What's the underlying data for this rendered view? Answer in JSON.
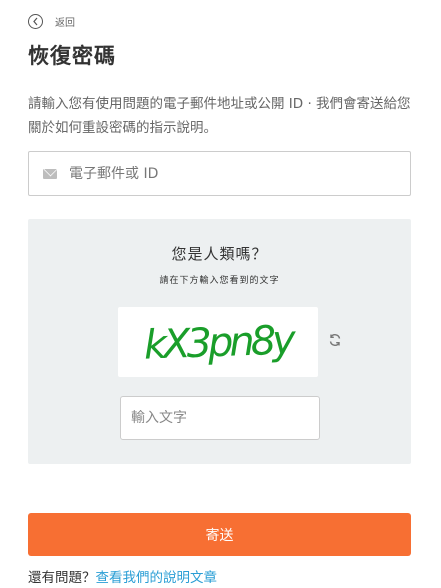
{
  "back": {
    "label": "返回",
    "icon": "chevron-left-circle-icon"
  },
  "title": "恢復密碼",
  "description": "請輸入您有使用問題的電子郵件地址或公開 ID · 我們會寄送給您關於如何重設密碼的指示說明。",
  "email_field": {
    "placeholder": "電子郵件或 ID",
    "value": "",
    "icon": "envelope-icon"
  },
  "captcha": {
    "title": "您是人類嗎？",
    "subtitle": "請在下方輸入您看到的文字",
    "image_text": "kX3pn8y",
    "image_color": "#1a9e2a",
    "refresh_icon": "refresh-icon",
    "input_placeholder": "輸入文字",
    "input_value": ""
  },
  "submit_label": "寄送",
  "help": {
    "prefix": "還有問題？",
    "link": "查看我們的說明文章"
  },
  "colors": {
    "accent": "#f76f33",
    "link": "#2a9ed5",
    "panel": "#edf0f1"
  }
}
